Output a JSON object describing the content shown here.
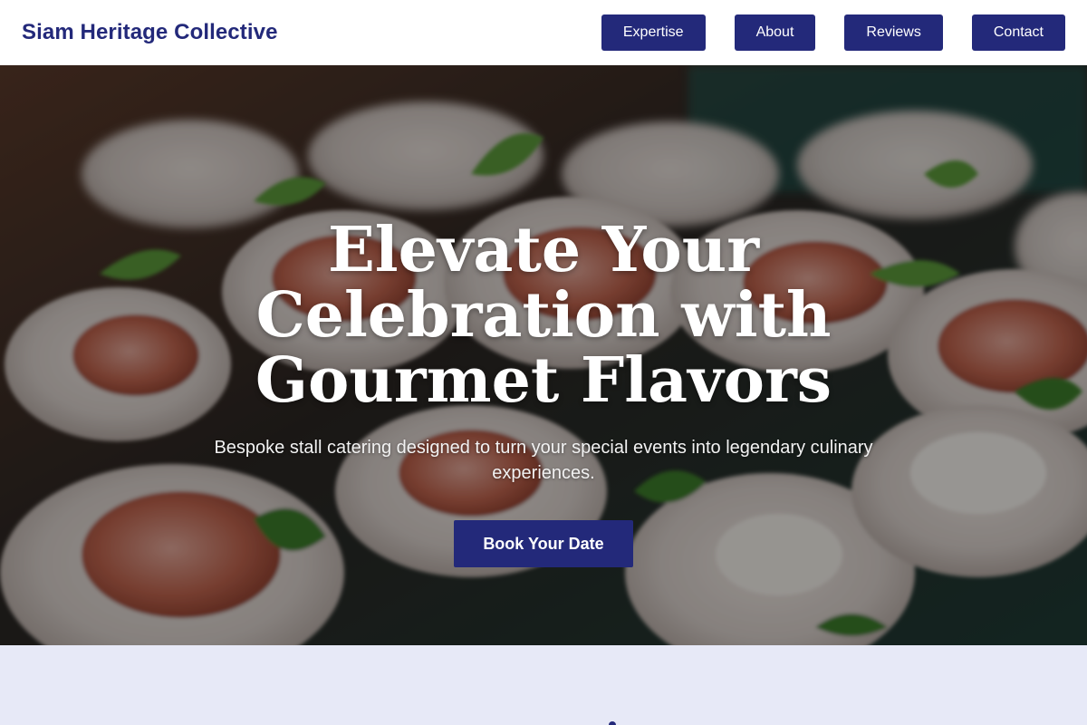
{
  "header": {
    "brand": "Siam Heritage Collective",
    "nav": [
      {
        "label": "Expertise"
      },
      {
        "label": "About"
      },
      {
        "label": "Reviews"
      },
      {
        "label": "Contact"
      }
    ]
  },
  "hero": {
    "title": "Elevate Your Celebration with Gourmet Flavors",
    "subtitle": "Bespoke stall catering designed to turn your special events into legendary culinary experiences.",
    "cta_label": "Book Your Date"
  },
  "colors": {
    "primary": "#23297a",
    "section_bg": "#e7e9f7",
    "text_on_dark": "#ffffff"
  },
  "icons": {
    "hero_image": "plated-appetizers-photo"
  }
}
